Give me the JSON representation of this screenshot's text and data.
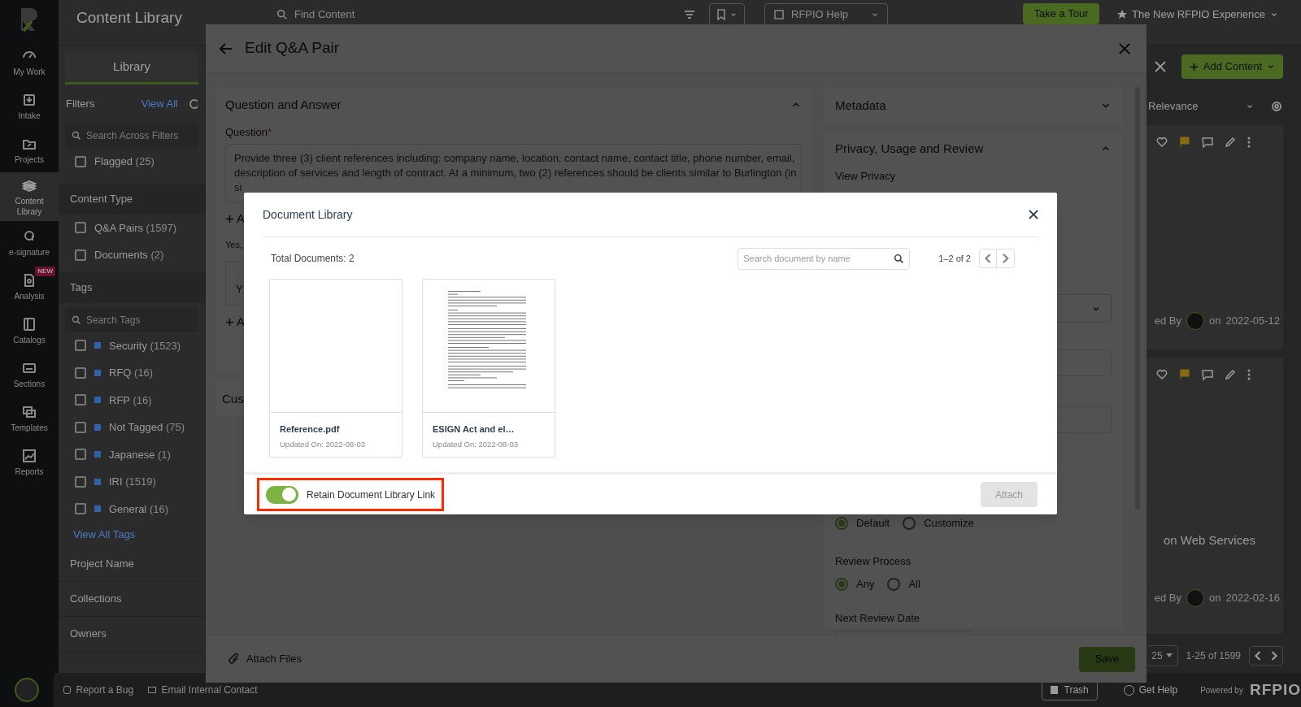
{
  "sidebar": {
    "items": [
      {
        "label": "My Work",
        "selected": false
      },
      {
        "label": "Intake",
        "selected": false
      },
      {
        "label": "Projects",
        "selected": false
      },
      {
        "label": "Content Library",
        "selected": true
      },
      {
        "label": "e-signature",
        "selected": false
      },
      {
        "label": "Analysis",
        "selected": false,
        "badge": "NEW"
      },
      {
        "label": "Catalogs",
        "selected": false
      },
      {
        "label": "Sections",
        "selected": false
      },
      {
        "label": "Templates",
        "selected": false
      },
      {
        "label": "Reports",
        "selected": false
      }
    ]
  },
  "header": {
    "title": "Content Library",
    "search_placeholder": "Find Content",
    "help": "RFPIO Help",
    "tour_button": "Take a Tour",
    "experience": "The New RFPIO Experience",
    "add_button": "Add Content"
  },
  "library_panel": {
    "tabs": [
      {
        "label": "Library",
        "selected": true
      }
    ],
    "filters_label": "Filters",
    "view_all": "View All",
    "search_placeholder": "Search Across Filters",
    "flags": [
      {
        "label": "Flagged",
        "count": "(25)",
        "checked": false
      }
    ],
    "content_type": {
      "title": "Content Type",
      "options": [
        {
          "label": "Q&A Pairs",
          "count": "(1597)",
          "checked": false
        },
        {
          "label": "Documents",
          "count": "(2)",
          "checked": false
        }
      ]
    },
    "tags": {
      "title": "Tags",
      "search_placeholder": "Search Tags",
      "options": [
        {
          "label": "Security",
          "count": "(1523)",
          "checked": false
        },
        {
          "label": "RFQ",
          "count": "(16)",
          "checked": false
        },
        {
          "label": "RFP",
          "count": "(16)",
          "checked": false
        },
        {
          "label": "Not Tagged",
          "count": "(75)",
          "checked": false
        },
        {
          "label": "Japanese",
          "count": "(1)",
          "checked": false
        },
        {
          "label": "IRI",
          "count": "(1519)",
          "checked": false
        },
        {
          "label": "General",
          "count": "(16)",
          "checked": false
        }
      ],
      "view_all": "View All Tags"
    },
    "collapsed_sections": [
      "Project Name",
      "Collections",
      "Owners"
    ]
  },
  "content": {
    "sort": "Relevance",
    "cards": [
      {
        "author_fragment": "ed By",
        "on": "on",
        "date": "2022-05-12"
      },
      {
        "title_fragment": "on Web Services",
        "author_fragment": "ed By",
        "on": "on",
        "date": "2022-02-16"
      }
    ],
    "page_size": "25",
    "range": "1-25 of 1599"
  },
  "footer": {
    "report": "Report a Bug",
    "email": "Email Internal Contact",
    "trash": "Trash",
    "help": "Get Help",
    "powered": "Powered by",
    "brand": "RFPIO"
  },
  "drawer": {
    "title": "Edit Q&A Pair",
    "qa": {
      "title": "Question and Answer",
      "expanded": true,
      "question_label": "Question",
      "required_mark": "*",
      "question_lines": [
        "Provide three (3) client references including: company name, location, contact name, contact title, phone number, email,",
        "description of services and length of contract. At a minimum, two (2) references should be clients similar to Burlington (in",
        "si"
      ],
      "add_link_1": "A",
      "answer_label": "Yes,",
      "answer_value": "Y",
      "add_link_2": "A"
    },
    "custom_section": "Cus",
    "metadata": {
      "title": "Metadata",
      "expanded": false
    },
    "privacy": {
      "title": "Privacy, Usage and Review",
      "expanded": true,
      "view_privacy": "View Privacy",
      "usage_options": [
        {
          "label": "Default",
          "selected": true
        },
        {
          "label": "Customize",
          "selected": false
        }
      ],
      "review_label": "Review Process",
      "review_options": [
        {
          "label": "Any",
          "selected": true
        },
        {
          "label": "All",
          "selected": false
        }
      ],
      "next_review_label": "Next Review Date"
    },
    "attach_files": "Attach Files",
    "save": "Save"
  },
  "modal": {
    "title": "Document Library",
    "total": "Total Documents: 2",
    "search_placeholder": "Search document by name",
    "range": "1–2 of 2",
    "documents": [
      {
        "name": "Reference.pdf",
        "updated": "Updated On: 2022-08-03",
        "kind": "blank"
      },
      {
        "name": "ESIGN Act and el…",
        "updated": "Updated On: 2022-08-03",
        "kind": "text"
      }
    ],
    "retain_link": {
      "label": "Retain Document Library Link",
      "on": true
    },
    "attach": {
      "label": "Attach",
      "disabled": true
    }
  }
}
